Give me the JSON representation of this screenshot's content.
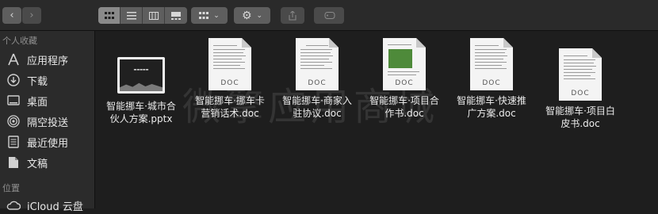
{
  "toolbar": {
    "back_icon": "chevron-left-icon",
    "forward_icon": "chevron-right-icon",
    "view_modes": [
      "icon-view-icon",
      "list-view-icon",
      "column-view-icon",
      "gallery-view-icon"
    ],
    "group_icon": "group-by-icon",
    "action_icon": "gear-icon",
    "share_icon": "share-icon",
    "tag_icon": "tag-icon"
  },
  "sidebar": {
    "favorites_title": "个人收藏",
    "items": [
      {
        "label": "应用程序",
        "icon": "applications-icon"
      },
      {
        "label": "下载",
        "icon": "downloads-icon"
      },
      {
        "label": "桌面",
        "icon": "desktop-icon"
      },
      {
        "label": "隔空投送",
        "icon": "airdrop-icon"
      },
      {
        "label": "最近使用",
        "icon": "recents-icon"
      },
      {
        "label": "文稿",
        "icon": "documents-icon"
      }
    ],
    "locations_title": "位置",
    "locations": [
      {
        "label": "iCloud 云盘",
        "icon": "icloud-icon"
      }
    ]
  },
  "files": [
    {
      "name_line1": "智能挪车·城市合",
      "name_line2": "伙人方案.pptx",
      "kind": "pptx",
      "thumb_badge": ""
    },
    {
      "name_line1": "智能挪车·挪车卡",
      "name_line2": "营销话术.doc",
      "kind": "doc",
      "thumb_badge": "DOC"
    },
    {
      "name_line1": "智能挪车·商家入",
      "name_line2": "驻协议.doc",
      "kind": "doc",
      "thumb_badge": "DOC"
    },
    {
      "name_line1": "智能挪车·项目合",
      "name_line2": "作书.doc",
      "kind": "doc",
      "thumb_badge": "DOC"
    },
    {
      "name_line1": "智能挪车·快速推",
      "name_line2": "广方案.doc",
      "kind": "doc",
      "thumb_badge": "DOC"
    },
    {
      "name_line1": "智能挪车·项目白",
      "name_line2": "皮书.doc",
      "kind": "doc",
      "thumb_badge": "DOC"
    }
  ],
  "watermark": "微擎应用商城"
}
